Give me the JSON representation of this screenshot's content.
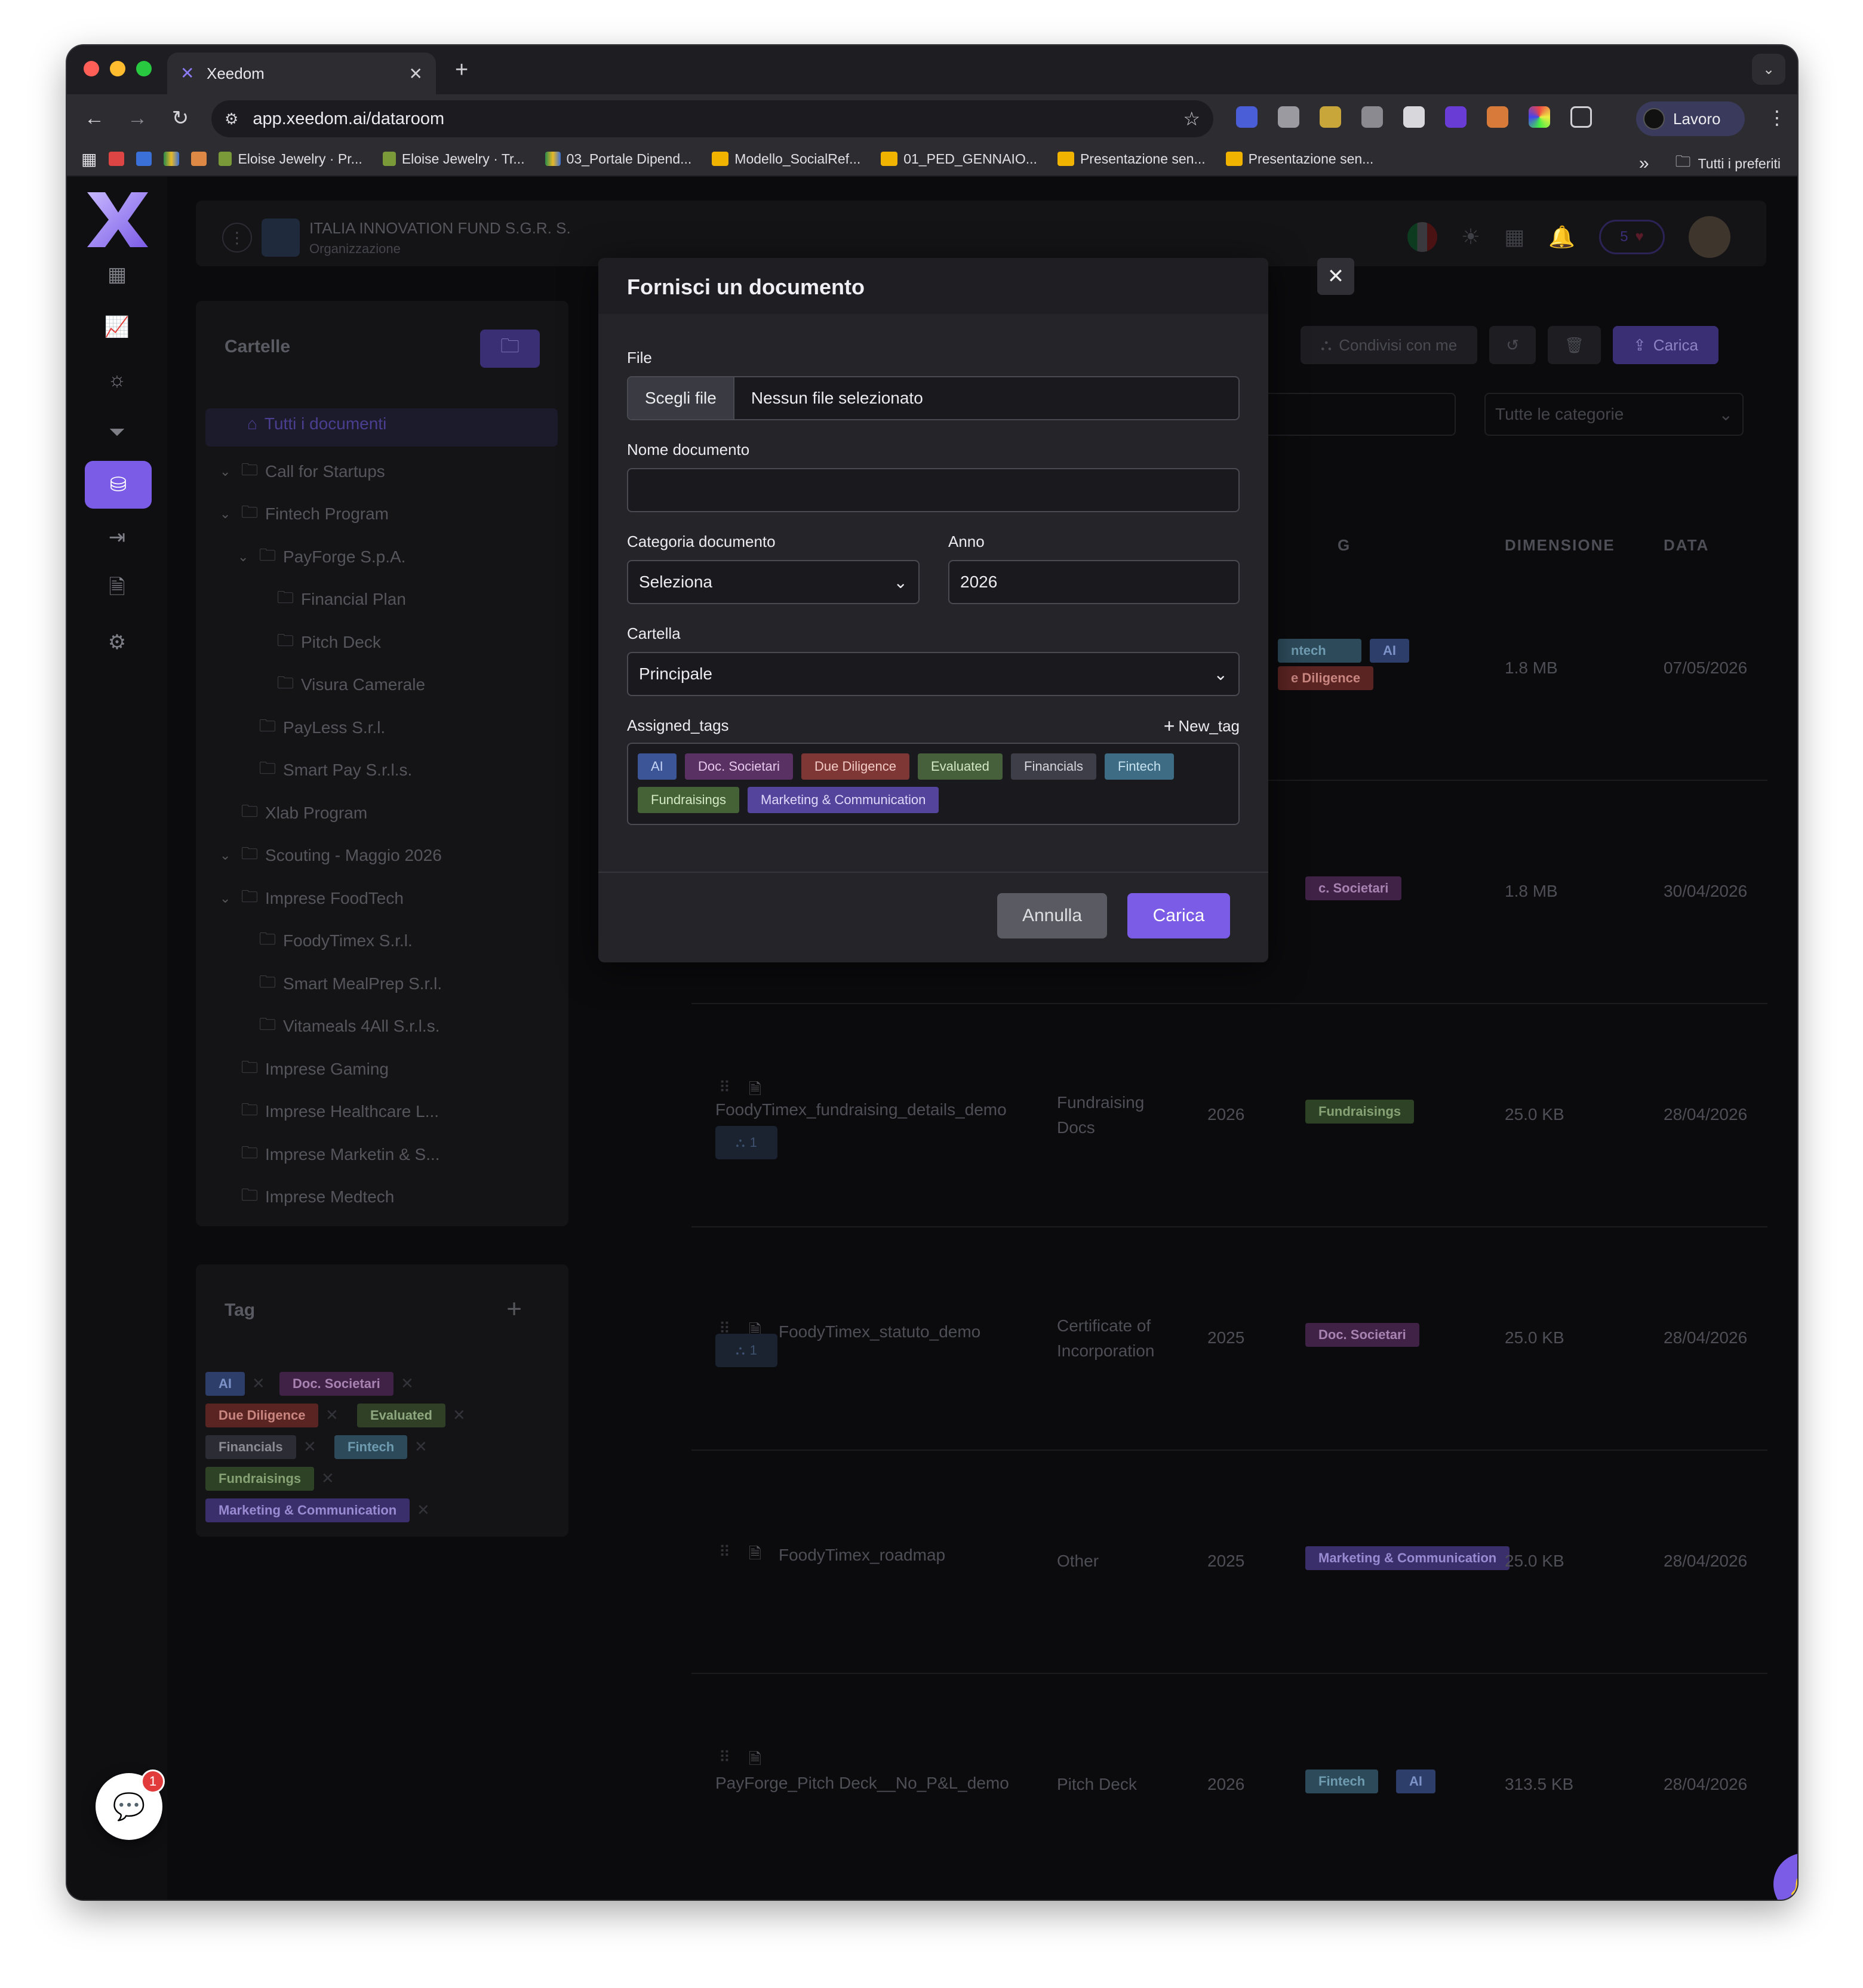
{
  "browser": {
    "tab_title": "Xeedom",
    "url": "app.xeedom.ai/dataroom",
    "profile": "Lavoro",
    "bookmarks": [
      "Eloise Jewelry · Pr...",
      "Eloise Jewelry · Tr...",
      "03_Portale Dipend...",
      "Modello_SocialRef...",
      "01_PED_GENNAIO...",
      "Presentazione sen...",
      "Presentazione sen..."
    ],
    "bookmarks_more": "»",
    "all_bookmarks": "Tutti i preferiti"
  },
  "header": {
    "org_name": "ITALIA INNOVATION FUND S.G.R. S.",
    "org_sub": "Organizzazione",
    "notif_count": "5"
  },
  "folders": {
    "title": "Cartelle",
    "items": [
      {
        "label": "Tutti i documenti",
        "level": 0,
        "chev": "",
        "icon": "⌂"
      },
      {
        "label": "Call for Startups",
        "level": 0,
        "chev": "⌄",
        "icon": "🗀"
      },
      {
        "label": "Fintech Program",
        "level": 1,
        "chev": "⌄",
        "icon": "🗀"
      },
      {
        "label": "PayForge S.p.A.",
        "level": 2,
        "chev": "⌄",
        "icon": "🗀"
      },
      {
        "label": "Financial Plan",
        "level": 3,
        "chev": "",
        "icon": "🗀"
      },
      {
        "label": "Pitch Deck",
        "level": 3,
        "chev": "",
        "icon": "🗀"
      },
      {
        "label": "Visura Camerale",
        "level": 3,
        "chev": "",
        "icon": "🗀"
      },
      {
        "label": "PayLess S.r.l.",
        "level": 2,
        "chev": "",
        "icon": "🗀"
      },
      {
        "label": "Smart Pay S.r.l.s.",
        "level": 2,
        "chev": "",
        "icon": "🗀"
      },
      {
        "label": "Xlab Program",
        "level": 1,
        "chev": "",
        "icon": "🗀"
      },
      {
        "label": "Scouting - Maggio 2026",
        "level": 0,
        "chev": "⌄",
        "icon": "🗀"
      },
      {
        "label": "Imprese FoodTech",
        "level": 1,
        "chev": "⌄",
        "icon": "🗀"
      },
      {
        "label": "FoodyTimex S.r.l.",
        "level": 2,
        "chev": "",
        "icon": "🗀"
      },
      {
        "label": "Smart MealPrep S.r.l.",
        "level": 2,
        "chev": "",
        "icon": "🗀"
      },
      {
        "label": "Vitameals 4All S.r.l.s.",
        "level": 2,
        "chev": "",
        "icon": "🗀"
      },
      {
        "label": "Imprese Gaming",
        "level": 1,
        "chev": "",
        "icon": "🗀"
      },
      {
        "label": "Imprese Healthcare L...",
        "level": 1,
        "chev": "",
        "icon": "🗀"
      },
      {
        "label": "Imprese Marketin & S...",
        "level": 1,
        "chev": "",
        "icon": "🗀"
      },
      {
        "label": "Imprese Medtech",
        "level": 1,
        "chev": "",
        "icon": "🗀"
      }
    ]
  },
  "tags": {
    "title": "Tag",
    "items": [
      {
        "label": "AI",
        "color": "#2d3e6b",
        "text": "#7d93c8"
      },
      {
        "label": "Doc. Societari",
        "color": "#3f2246",
        "text": "#a883b2"
      },
      {
        "label": "Due Diligence",
        "color": "#5a2422",
        "text": "#c98680"
      },
      {
        "label": "Evaluated",
        "color": "#2f4027",
        "text": "#8fa77f"
      },
      {
        "label": "Financials",
        "color": "#2c2c34",
        "text": "#8b8b95"
      },
      {
        "label": "Fintech",
        "color": "#2d4a5a",
        "text": "#6f9bb0"
      },
      {
        "label": "Fundraisings",
        "color": "#2e4226",
        "text": "#86a274"
      },
      {
        "label": "Marketing & Communication",
        "color": "#3a2f6b",
        "text": "#9a8ad2"
      }
    ]
  },
  "actions": {
    "shared": "Condivisi con me",
    "upload": "Carica",
    "category_filter": "Tutte le categorie"
  },
  "table": {
    "columns": {
      "tags_partial": "G",
      "size": "DIMENSIONE",
      "date": "DATA"
    },
    "rows": [
      {
        "name": "",
        "category": "",
        "year": "",
        "tags": [
          "ntech",
          "AI",
          "e Diligence"
        ],
        "size": "1.8 MB",
        "date": "07/05/2026",
        "shares": ""
      },
      {
        "name": "",
        "category": "",
        "year": "",
        "tags": [
          "c. Societari"
        ],
        "size": "1.8 MB",
        "date": "30/04/2026",
        "shares": ""
      },
      {
        "name": "FoodyTimex_fundraising_details_demo",
        "category": "Fundraising Docs",
        "year": "2026",
        "tags": [
          "Fundraisings"
        ],
        "size": "25.0 KB",
        "date": "28/04/2026",
        "shares": "1"
      },
      {
        "name": "FoodyTimex_statuto_demo",
        "category": "Certificate of Incorporation",
        "year": "2025",
        "tags": [
          "Doc. Societari"
        ],
        "size": "25.0 KB",
        "date": "28/04/2026",
        "shares": "1"
      },
      {
        "name": "FoodyTimex_roadmap",
        "category": "Other",
        "year": "2025",
        "tags": [
          "Marketing & Communication"
        ],
        "size": "25.0 KB",
        "date": "28/04/2026",
        "shares": ""
      },
      {
        "name": "PayForge_Pitch Deck__No_P&L_demo",
        "category": "Pitch Deck",
        "year": "2026",
        "tags": [
          "Fintech",
          "AI"
        ],
        "size": "313.5 KB",
        "date": "28/04/2026",
        "shares": ""
      }
    ]
  },
  "modal": {
    "title": "Fornisci un documento",
    "file_label": "File",
    "choose_file": "Scegli file",
    "no_file": "Nessun file selezionato",
    "name_label": "Nome documento",
    "name_value": "",
    "category_label": "Categoria documento",
    "category_value": "Seleziona",
    "year_label": "Anno",
    "year_value": "2026",
    "folder_label": "Cartella",
    "folder_value": "Principale",
    "tags_label": "Assigned_tags",
    "new_tag": "New_tag",
    "tags": [
      {
        "label": "AI",
        "color": "#3b5597",
        "text": "#c5d3f5"
      },
      {
        "label": "Doc. Societari",
        "color": "#5a3163",
        "text": "#e5c8ec"
      },
      {
        "label": "Due Diligence",
        "color": "#7e3734",
        "text": "#f3cbc6"
      },
      {
        "label": "Evaluated",
        "color": "#46603b",
        "text": "#d3e6c6"
      },
      {
        "label": "Financials",
        "color": "#3e3e48",
        "text": "#d6d6de"
      },
      {
        "label": "Fintech",
        "color": "#3e6c84",
        "text": "#c6e2ef"
      },
      {
        "label": "Fundraisings",
        "color": "#456236",
        "text": "#d3e8c3"
      },
      {
        "label": "Marketing & Communication",
        "color": "#54449b",
        "text": "#e0d8fb"
      }
    ],
    "cancel": "Annulla",
    "submit": "Carica"
  },
  "chat_badge": "1"
}
